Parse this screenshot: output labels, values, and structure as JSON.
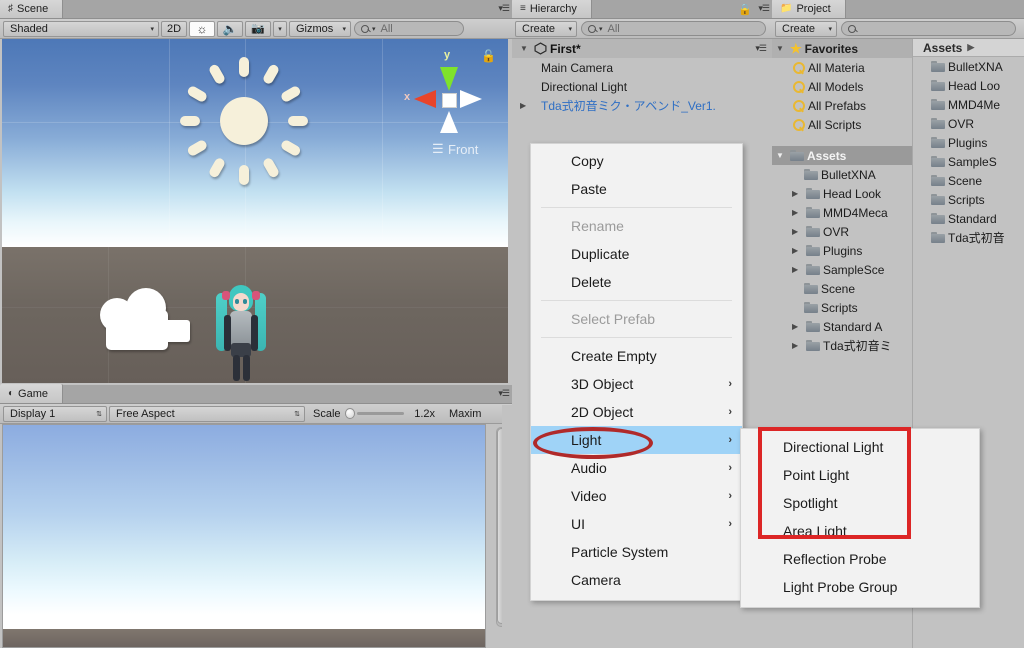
{
  "scene_panel": {
    "tab_label": "Scene",
    "tab_icon": "grid-icon",
    "toolbar": {
      "draw_mode": "Shaded",
      "two_d": "2D",
      "lighting_icon": "sun-icon",
      "audio_icon": "speaker-icon",
      "fx_icon": "image-icon",
      "gizmos": "Gizmos",
      "search_placeholder": "All",
      "search_value": ""
    },
    "gizmo": {
      "y_label": "y",
      "x_label": "x",
      "view_label": "Front",
      "lock_icon": "unlock-icon"
    },
    "objects": {
      "sun_gizmo": "directional-light-gizmo",
      "camera_gizmo": "camera-gizmo",
      "character": "miku-model"
    }
  },
  "game_panel": {
    "tab_label": "Game",
    "tab_icon": "gamepad-icon",
    "toolbar": {
      "display": "Display 1",
      "aspect": "Free Aspect",
      "scale_label": "Scale",
      "scale_value": "1.2x",
      "maximize": "Maxim"
    }
  },
  "hierarchy": {
    "tab_label": "Hierarchy",
    "tab_icon": "list-icon",
    "create_label": "Create",
    "search_placeholder": "All",
    "search_value": "",
    "lock_icon": "lock-icon",
    "scene_name": "First*",
    "items": [
      {
        "label": "Main Camera",
        "type": "gameobject",
        "expandable": false
      },
      {
        "label": "Directional Light",
        "type": "gameobject",
        "expandable": false
      },
      {
        "label": "Tda式初音ミク・アベンド_Ver1.",
        "type": "prefab",
        "expandable": true
      }
    ]
  },
  "project": {
    "tab_label": "Project",
    "tab_icon": "folder-icon",
    "create_label": "Create",
    "search_placeholder": "",
    "search_value": "",
    "favorites_label": "Favorites",
    "favorites": [
      "All Materia",
      "All Models",
      "All Prefabs",
      "All Scripts"
    ],
    "assets_label": "Assets",
    "tree": [
      {
        "label": "BulletXNA",
        "expandable": false
      },
      {
        "label": "Head Look",
        "expandable": true
      },
      {
        "label": "MMD4Meca",
        "expandable": true
      },
      {
        "label": "OVR",
        "expandable": true
      },
      {
        "label": "Plugins",
        "expandable": true
      },
      {
        "label": "SampleSce",
        "expandable": true
      },
      {
        "label": "Scene",
        "expandable": false
      },
      {
        "label": "Scripts",
        "expandable": false
      },
      {
        "label": "Standard A",
        "expandable": true
      },
      {
        "label": "Tda式初音ミ",
        "expandable": true
      }
    ],
    "breadcrumb": "Assets",
    "contents": [
      "BulletXNA",
      "Head Loo",
      "MMD4Me",
      "OVR",
      "Plugins",
      "SampleS",
      "Scene",
      "Scripts",
      "Standard",
      "Tda式初音"
    ]
  },
  "context_menu": {
    "items": [
      {
        "label": "Copy",
        "state": "normal",
        "submenu": false
      },
      {
        "label": "Paste",
        "state": "normal",
        "submenu": false
      },
      {
        "separator": true
      },
      {
        "label": "Rename",
        "state": "disabled",
        "submenu": false
      },
      {
        "label": "Duplicate",
        "state": "normal",
        "submenu": false
      },
      {
        "label": "Delete",
        "state": "normal",
        "submenu": false
      },
      {
        "separator": true
      },
      {
        "label": "Select Prefab",
        "state": "disabled",
        "submenu": false
      },
      {
        "separator": true
      },
      {
        "label": "Create Empty",
        "state": "normal",
        "submenu": false
      },
      {
        "label": "3D Object",
        "state": "normal",
        "submenu": true
      },
      {
        "label": "2D Object",
        "state": "normal",
        "submenu": true
      },
      {
        "label": "Light",
        "state": "highlighted",
        "submenu": true
      },
      {
        "label": "Audio",
        "state": "normal",
        "submenu": true
      },
      {
        "label": "Video",
        "state": "normal",
        "submenu": true
      },
      {
        "label": "UI",
        "state": "normal",
        "submenu": true
      },
      {
        "label": "Particle System",
        "state": "normal",
        "submenu": false
      },
      {
        "label": "Camera",
        "state": "normal",
        "submenu": false
      }
    ]
  },
  "sub_menu": {
    "items": [
      {
        "label": "Directional Light"
      },
      {
        "label": "Point Light"
      },
      {
        "label": "Spotlight"
      },
      {
        "label": "Area Light"
      },
      {
        "label": "Reflection Probe"
      },
      {
        "label": "Light Probe Group"
      }
    ]
  },
  "annotations": {
    "ellipse_target": "Light",
    "ellipse_color": "#b02a2a",
    "rect_target": "light-types-group",
    "rect_color": "#dc2626"
  },
  "colors": {
    "panel_bg": "#c2c2c2",
    "toolbar_bg": "#cfcfcf",
    "menu_bg": "#f2f2f2",
    "menu_highlight": "#9fd3f7",
    "prefab_blue": "#2f6fc4",
    "favorite_star": "#f5c22b"
  }
}
